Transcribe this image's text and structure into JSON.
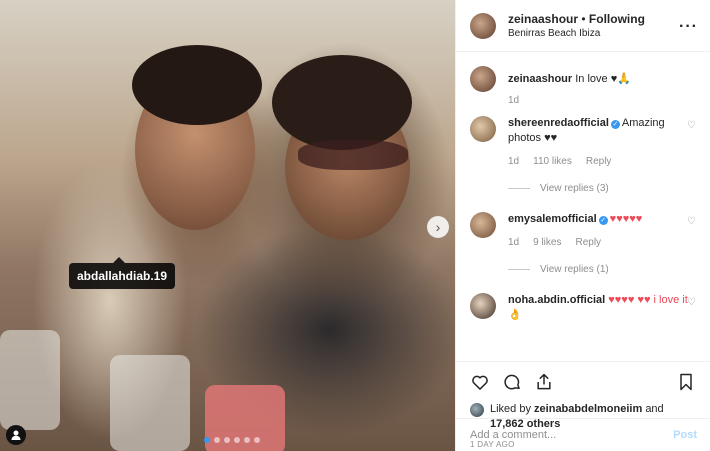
{
  "photo": {
    "tag_label": "abdallahdiab.19",
    "slides": 6,
    "active_slide": 0
  },
  "header": {
    "username": "zeinaashour",
    "separator": "•",
    "follow_label": "Following",
    "location": "Benirras Beach Ibiza"
  },
  "caption": {
    "username": "zeinaashour",
    "text": "In love ♥🙏",
    "age": "1d"
  },
  "comments": [
    {
      "username": "shereenredaofficial",
      "verified": true,
      "text": "Amazing photos ♥♥",
      "age": "1d",
      "likes": "110 likes",
      "reply_label": "Reply",
      "view_replies": "View replies (3)"
    },
    {
      "username": "emysalemofficial",
      "verified": true,
      "text": "♥♥♥♥♥",
      "age": "1d",
      "likes": "9 likes",
      "reply_label": "Reply",
      "view_replies": "View replies (1)"
    },
    {
      "username": "noha.abdin.official",
      "verified": false,
      "text": "♥♥♥♥ ♥♥ i love it 👌",
      "age": "",
      "likes": "",
      "reply_label": "",
      "view_replies": ""
    }
  ],
  "likes": {
    "prefix": "Liked by",
    "user": "zeinababdelmoneiim",
    "connector": "and",
    "others": "17,862 others"
  },
  "date": "1 DAY AGO",
  "add_comment": {
    "placeholder": "Add a comment...",
    "post_label": "Post"
  },
  "colors": {
    "accent": "#3897f0",
    "heart": "#ed4956",
    "muted": "#8e8e8e"
  }
}
